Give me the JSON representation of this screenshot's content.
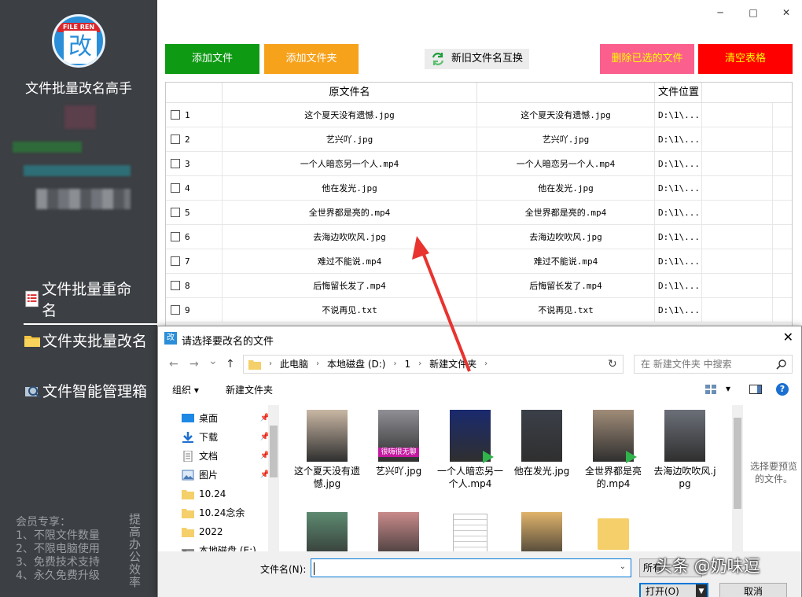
{
  "app": {
    "name": "文件批量改名高手",
    "logo_banner": "FILE REN",
    "logo_glyph": "改"
  },
  "sidebar": {
    "items": [
      {
        "label": "文件批量重命名",
        "active": true,
        "icon": "document-list-icon"
      },
      {
        "label": "文件夹批量改名",
        "active": false,
        "icon": "folder-icon"
      },
      {
        "label": "文件智能管理箱",
        "active": false,
        "icon": "manager-toolbox-icon"
      }
    ],
    "vip_lines": [
      "会员专享：",
      "1、不限文件数量",
      "2、不限电脑使用",
      "3、免费技术支持",
      "4、永久免费升级"
    ],
    "vip_side": "提高办公效率"
  },
  "window": {
    "minimize": "─",
    "maximize": "□",
    "close": "✕"
  },
  "toolbar": {
    "add_file": "添加文件",
    "add_folder": "添加文件夹",
    "swap_names": "新旧文件名互换",
    "delete_selected": "删除已选的文件",
    "clear_table": "清空表格",
    "colors": {
      "add_file": "#0f9a14",
      "add_folder": "#f7a21b",
      "delete_selected": "#fb5f8d",
      "clear_table": "#ff0000"
    }
  },
  "table": {
    "headers": [
      "原文件名",
      "",
      "文件位置"
    ],
    "rows": [
      {
        "num": "1",
        "original": "这个夏天没有遗憾.jpg",
        "new": "这个夏天没有遗憾.jpg",
        "path": "D:\\1\\..."
      },
      {
        "num": "2",
        "original": "艺兴吖.jpg",
        "new": "艺兴吖.jpg",
        "path": "D:\\1\\..."
      },
      {
        "num": "3",
        "original": "一个人暗恋另一个人.mp4",
        "new": "一个人暗恋另一个人.mp4",
        "path": "D:\\1\\..."
      },
      {
        "num": "4",
        "original": "他在发光.jpg",
        "new": "他在发光.jpg",
        "path": "D:\\1\\..."
      },
      {
        "num": "5",
        "original": "全世界都是亮的.mp4",
        "new": "全世界都是亮的.mp4",
        "path": "D:\\1\\..."
      },
      {
        "num": "6",
        "original": "去海边吹吹风.jpg",
        "new": "去海边吹吹风.jpg",
        "path": "D:\\1\\..."
      },
      {
        "num": "7",
        "original": "难过不能说.mp4",
        "new": "难过不能说.mp4",
        "path": "D:\\1\\..."
      },
      {
        "num": "8",
        "original": "后悔留长发了.mp4",
        "new": "后悔留长发了.mp4",
        "path": "D:\\1\\..."
      },
      {
        "num": "9",
        "original": "不说再见.txt",
        "new": "不说再见.txt",
        "path": "D:\\1\\..."
      }
    ]
  },
  "dialog": {
    "title": "请选择要改名的文件",
    "title_icon": "改",
    "close": "✕",
    "nav": {
      "back": "←",
      "forward": "→",
      "history": "⌄",
      "up": "↑"
    },
    "breadcrumb": [
      "此电脑",
      "本地磁盘 (D:)",
      "1",
      "新建文件夹"
    ],
    "refresh": "↻",
    "search_placeholder": "在 新建文件夹 中搜索",
    "organize": "组织 ▾",
    "new_folder": "新建文件夹",
    "view_toggle": "▾",
    "help": "?",
    "nav_pane": [
      {
        "label": "桌面",
        "icon": "desktop-icon",
        "pinned": true
      },
      {
        "label": "下载",
        "icon": "download-icon",
        "pinned": true
      },
      {
        "label": "文档",
        "icon": "document-icon",
        "pinned": true
      },
      {
        "label": "图片",
        "icon": "picture-icon",
        "pinned": true
      },
      {
        "label": "10.24",
        "icon": "folder-icon",
        "pinned": false
      },
      {
        "label": "10.24念余",
        "icon": "folder-icon",
        "pinned": false
      },
      {
        "label": "2022",
        "icon": "folder-icon",
        "pinned": false
      },
      {
        "label": "本地磁盘 (E:)",
        "icon": "drive-icon",
        "pinned": false
      }
    ],
    "files": [
      {
        "name": "这个夏天没有遗憾.jpg",
        "type": "image",
        "bg": "#c9b7a4"
      },
      {
        "name": "艺兴吖.jpg",
        "type": "image",
        "bg": "#8f8f95",
        "caption": "很嗨很无聊"
      },
      {
        "name": "一个人暗恋另一个人.mp4",
        "type": "video",
        "bg": "#1a2a6e"
      },
      {
        "name": "他在发光.jpg",
        "type": "image",
        "bg": "#3b3f48"
      },
      {
        "name": "全世界都是亮的.mp4",
        "type": "video",
        "bg": "#a08c78"
      },
      {
        "name": "去海边吹吹风.jpg",
        "type": "image",
        "bg": "#6b6f78"
      },
      {
        "name": "",
        "type": "image",
        "bg": "#5d8a70"
      },
      {
        "name": "",
        "type": "image",
        "bg": "#c98a8a"
      },
      {
        "name": "",
        "type": "text",
        "bg": "#ffffff"
      },
      {
        "name": "",
        "type": "image",
        "bg": "#e0b36a"
      },
      {
        "name": "",
        "type": "folder",
        "bg": "#f4cf6a"
      }
    ],
    "preview_text": "选择要预览的文件。",
    "filename_label": "文件名(N):",
    "filename_value": "",
    "filter_label": "所有",
    "open": "打开(O)",
    "cancel": "取消"
  },
  "watermark": "头条 @奶味逗"
}
